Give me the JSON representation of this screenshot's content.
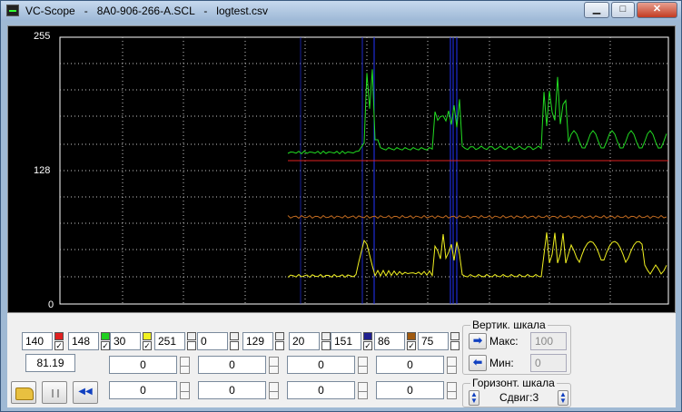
{
  "window": {
    "title": "VC-Scope   -   8A0-906-266-A.SCL   -   logtest.csv",
    "min_glyph": "▁",
    "max_glyph": "□",
    "close_glyph": "✕"
  },
  "scope": {
    "y_labels": {
      "top": "255",
      "mid": "128",
      "bottom": "0"
    }
  },
  "channels": [
    {
      "value": "140",
      "color": "#e02020",
      "checked": "✓"
    },
    {
      "value": "148",
      "color": "#20d020",
      "checked": "✓"
    },
    {
      "value": "30",
      "color": "#f0f020",
      "checked": "✓"
    },
    {
      "value": "251",
      "color": "",
      "checked": ""
    },
    {
      "value": "0",
      "color": "",
      "checked": ""
    },
    {
      "value": "129",
      "color": "",
      "checked": ""
    },
    {
      "value": "20",
      "color": "",
      "checked": ""
    },
    {
      "value": "151",
      "color": "#202090",
      "checked": "✓"
    },
    {
      "value": "86",
      "color": "#a05a10",
      "checked": "✓"
    },
    {
      "value": "75",
      "color": "",
      "checked": ""
    }
  ],
  "readout": "81.19",
  "value_rows": [
    [
      "0",
      "0",
      "0",
      "0"
    ],
    [
      "0",
      "0",
      "0",
      "0"
    ]
  ],
  "vertical_scale": {
    "title": "Вертик. шкала",
    "max_label": "Макс:",
    "max_value": "100",
    "min_label": "Мин:",
    "min_value": "0"
  },
  "horizontal_scale": {
    "title": "Горизонт. шкала",
    "shift_label": "Сдвиг:3"
  },
  "colors": {
    "grid": "#c8c8c8",
    "green": "#22dd22",
    "red": "#e02020",
    "orange": "#c06a20",
    "yellow": "#f0f020",
    "blue": "#2233ff"
  }
}
